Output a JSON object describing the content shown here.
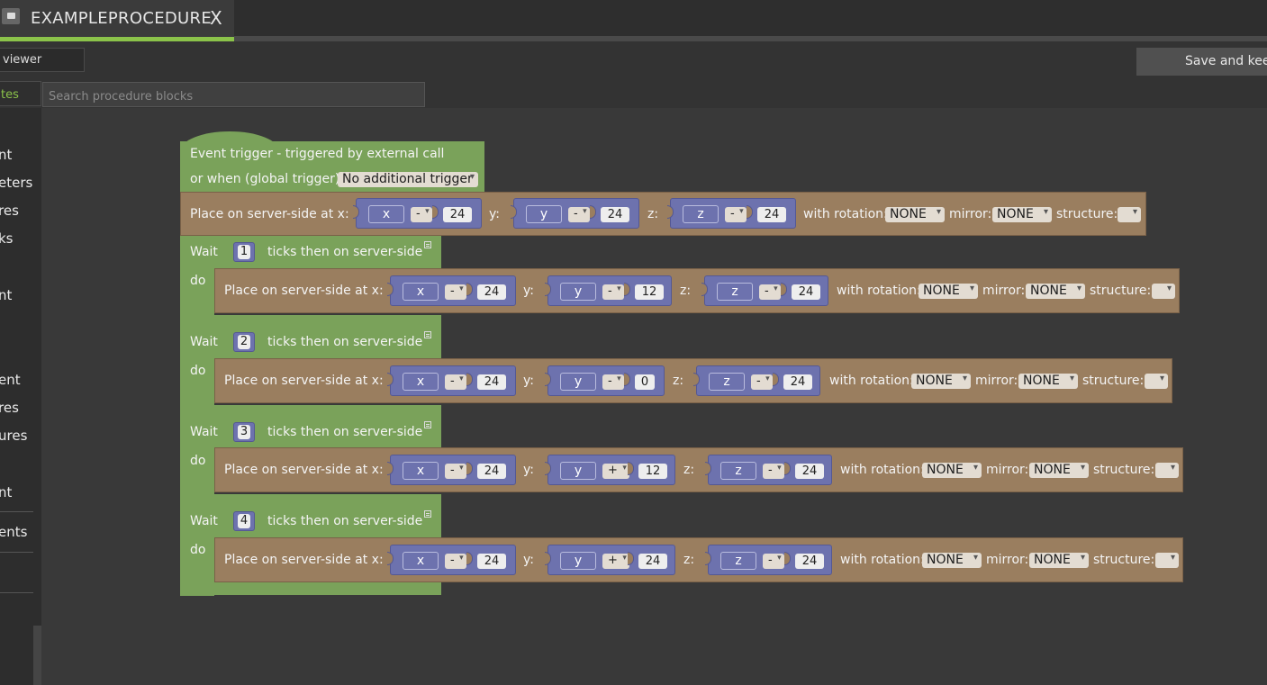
{
  "tab": {
    "title": "EXAMPLEPROCEDURE",
    "close": "X"
  },
  "toolbar": {
    "viewer_label": "viewer",
    "save_label": "Save and keep"
  },
  "search": {
    "tab_label": "tes",
    "placeholder": "Search procedure blocks"
  },
  "sidebar": {
    "items": [
      "nt",
      "eters",
      "res",
      "ks",
      "nt",
      "ent",
      "res",
      "ures",
      "nt",
      "ents"
    ]
  },
  "colors": {
    "accent": "#8bc34a",
    "event_block": "#7aa25a",
    "action_block": "#9a7e5f",
    "math_block": "#6d72ae"
  },
  "event": {
    "line1": "Event trigger - triggered by external call",
    "line2": "or when (global trigger):",
    "trigger": "No additional trigger"
  },
  "labels": {
    "place": "Place on server-side at x:",
    "y": "y:",
    "z": "z:",
    "rotation": "with rotation:",
    "mirror": "mirror:",
    "structure": "structure:",
    "wait": "Wait",
    "ticks": "ticks then on server-side",
    "do": "do",
    "x_var": "x",
    "y_var": "y",
    "z_var": "z",
    "none": "NONE"
  },
  "first_place": {
    "x_op": "-",
    "x_val": "24",
    "y_op": "-",
    "y_val": "24",
    "z_op": "-",
    "z_val": "24"
  },
  "waits": [
    {
      "ticks": "1",
      "x_op": "-",
      "x_val": "24",
      "y_op": "-",
      "y_val": "12",
      "z_op": "-",
      "z_val": "24"
    },
    {
      "ticks": "2",
      "x_op": "-",
      "x_val": "24",
      "y_op": "-",
      "y_val": "0",
      "z_op": "-",
      "z_val": "24"
    },
    {
      "ticks": "3",
      "x_op": "-",
      "x_val": "24",
      "y_op": "+",
      "y_val": "12",
      "z_op": "-",
      "z_val": "24"
    },
    {
      "ticks": "4",
      "x_op": "-",
      "x_val": "24",
      "y_op": "+",
      "y_val": "24",
      "z_op": "-",
      "z_val": "24"
    }
  ]
}
